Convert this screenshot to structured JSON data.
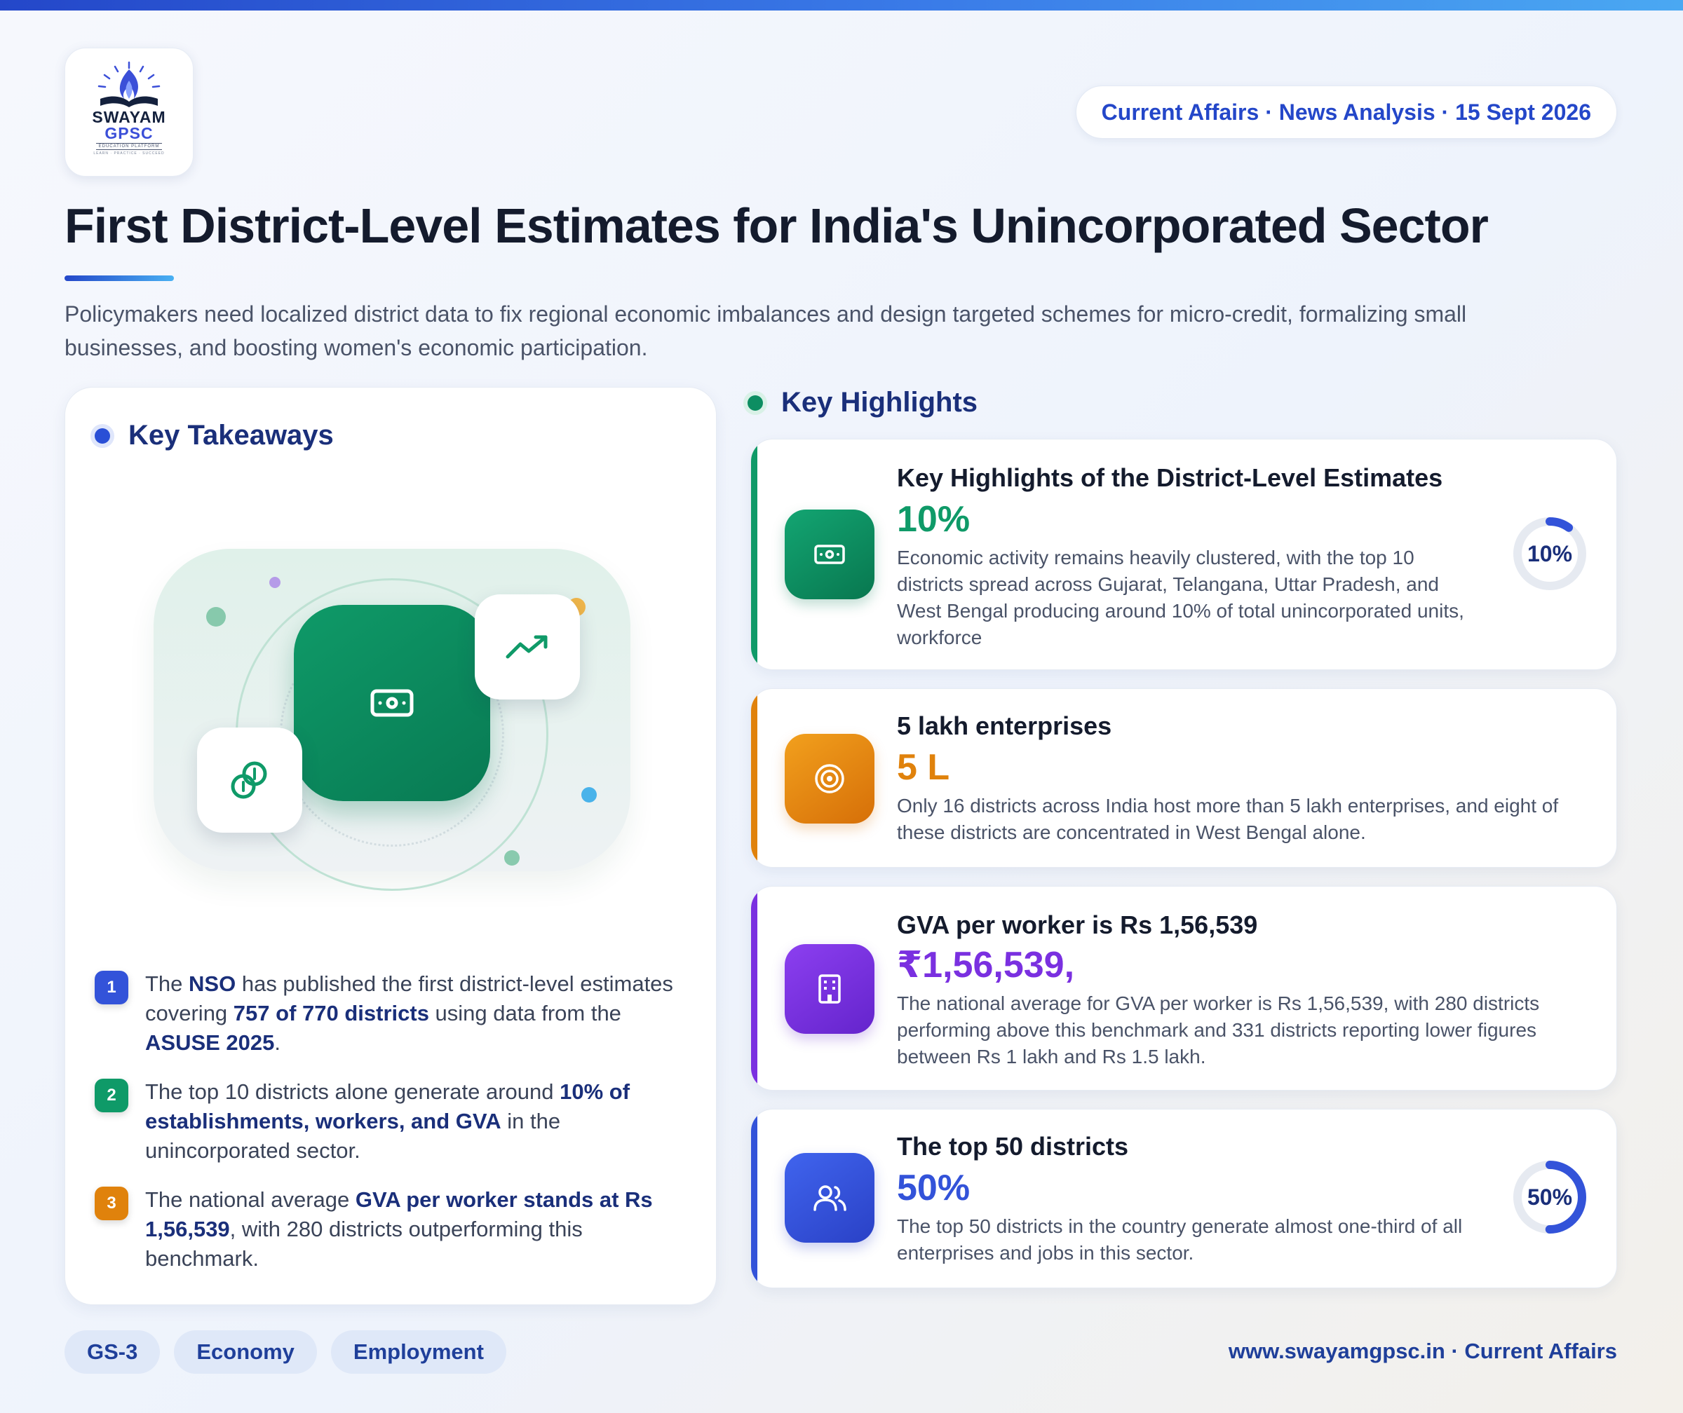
{
  "logo": {
    "line1": "SWAYAM",
    "line2": "GPSC",
    "tagline": "EDUCATION PLATFORM",
    "motto": "LEARN · PRACTICE · SUCCEED"
  },
  "header": {
    "date_pill": "Current Affairs · News Analysis · 15 Sept 2026",
    "title": "First District-Level Estimates for India's Unincorporated Sector",
    "subtitle": "Policymakers need localized district data to fix regional economic imbalances and design targeted schemes for micro-credit, formalizing small businesses, and boosting women's economic participation."
  },
  "takeaways": {
    "heading": "Key Takeaways",
    "items": [
      {
        "num": "1",
        "color": "#3353d9",
        "parts": [
          {
            "t": "The ",
            "b": false
          },
          {
            "t": "NSO",
            "b": true
          },
          {
            "t": " has published the first district-level estimates covering ",
            "b": false
          },
          {
            "t": "757 of 770 districts",
            "b": true
          },
          {
            "t": " using data from the ",
            "b": false
          },
          {
            "t": "ASUSE 2025",
            "b": true
          },
          {
            "t": ".",
            "b": false
          }
        ]
      },
      {
        "num": "2",
        "color": "#0f9a68",
        "parts": [
          {
            "t": "The top 10 districts alone generate around ",
            "b": false
          },
          {
            "t": "10% of establishments, workers, and GVA",
            "b": true
          },
          {
            "t": " in the unincorporated sector.",
            "b": false
          }
        ]
      },
      {
        "num": "3",
        "color": "#e0820c",
        "parts": [
          {
            "t": "The national average ",
            "b": false
          },
          {
            "t": "GVA per worker stands at Rs 1,56,539",
            "b": true
          },
          {
            "t": ", with 280 districts outperforming this benchmark.",
            "b": false
          }
        ]
      }
    ]
  },
  "highlights": {
    "heading": "Key Highlights",
    "items": [
      {
        "title": "Key Highlights of the District-Level Estimates",
        "value": "10%",
        "desc": "Economic activity remains heavily clustered, with the top 10 districts spread across Gujarat, Telangana, Uttar Pradesh, and West Bengal producing around 10% of total unincorporated units, workforce",
        "color": "#0f9a68",
        "icon": "banknote-icon",
        "donut_label": "10%",
        "donut_percent": 10
      },
      {
        "title": "5 lakh enterprises",
        "value": "5 L",
        "desc": "Only 16 districts across India host more than 5 lakh enterprises, and eight of these districts are concentrated in West Bengal alone.",
        "color": "#e0820c",
        "icon": "target-icon"
      },
      {
        "title": "GVA per worker is Rs 1,56,539",
        "value": "₹1,56,539,",
        "desc": "The national average for GVA per worker is Rs 1,56,539, with 280 districts performing above this benchmark and 331 districts reporting lower figures between Rs 1 lakh and Rs 1.5 lakh.",
        "color": "#7a30e0",
        "icon": "building-icon"
      },
      {
        "title": "The top 50 districts",
        "value": "50%",
        "desc": "The top 50 districts in the country generate almost one-third of all enterprises and jobs in this sector.",
        "color": "#3353d9",
        "icon": "users-icon",
        "donut_label": "50%",
        "donut_percent": 50
      }
    ]
  },
  "footer": {
    "tags": [
      "GS-3",
      "Economy",
      "Employment"
    ],
    "site": "www.swayamgpsc.in · Current Affairs"
  }
}
